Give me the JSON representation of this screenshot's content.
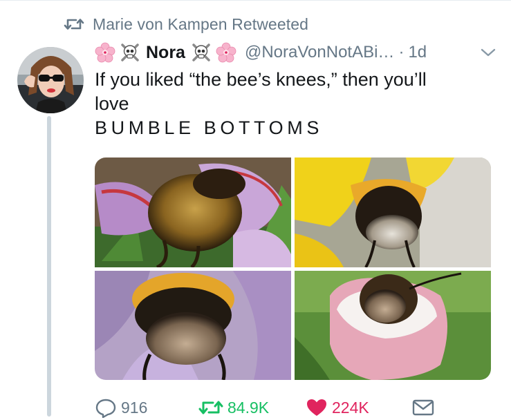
{
  "retweet_context": {
    "text": "Marie von Kampen Retweeted",
    "icon": "retweet-icon"
  },
  "tweet": {
    "author": {
      "name": "Nora",
      "handle": "@NoraVonNotABi…",
      "name_emoji_left": [
        "cherry-blossom",
        "skull-crossbones"
      ],
      "name_emoji_right": [
        "skull-crossbones",
        "cherry-blossom"
      ]
    },
    "time": "1d",
    "separator": "·",
    "text_lines": [
      "If you liked “the bee’s knees,” then you’ll",
      "love",
      "BUMBLE BOTTOMS"
    ],
    "media_count": 4,
    "actions": {
      "reply_count": "916",
      "retweet_count": "84.9K",
      "like_count": "224K"
    }
  },
  "colors": {
    "secondary_text": "#657786",
    "retweet_green": "#17bf63",
    "like_red": "#e0245e",
    "thread_line": "#ccd6dd"
  }
}
